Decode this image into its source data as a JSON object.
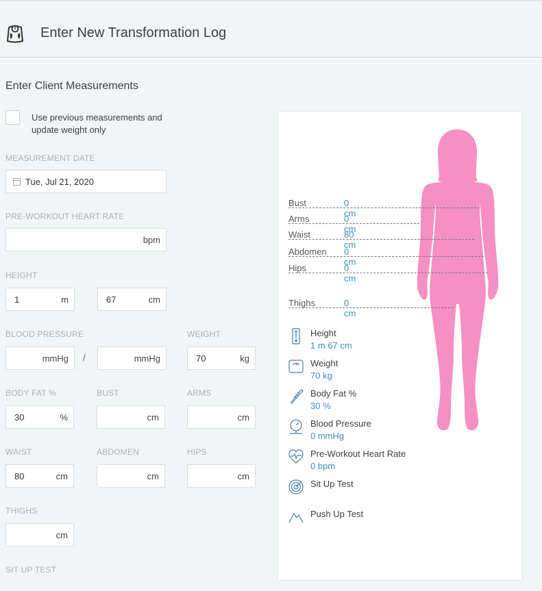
{
  "header": {
    "title": "Enter New Transformation Log",
    "icon": "scale-icon"
  },
  "form": {
    "section_title": "Enter Client Measurements",
    "use_previous_label": "Use previous measurements and update weight only",
    "use_previous_checked": false,
    "measurement_date": {
      "label": "MEASUREMENT DATE",
      "value": "Tue, Jul 21, 2020"
    },
    "heart_rate": {
      "label": "PRE-WORKOUT HEART RATE",
      "value": "",
      "unit": "bpm"
    },
    "height": {
      "label": "HEIGHT",
      "m_value": "1",
      "m_unit": "m",
      "cm_value": "67",
      "cm_unit": "cm"
    },
    "blood_pressure": {
      "label": "BLOOD PRESSURE",
      "systolic": "",
      "systolic_unit": "mmHg",
      "separator": "/",
      "diastolic": "",
      "diastolic_unit": "mmHg"
    },
    "weight": {
      "label": "WEIGHT",
      "value": "70",
      "unit": "kg"
    },
    "body_fat": {
      "label": "BODY FAT %",
      "value": "30",
      "unit": "%"
    },
    "bust": {
      "label": "BUST",
      "value": "",
      "unit": "cm"
    },
    "arms": {
      "label": "ARMS",
      "value": "",
      "unit": "cm"
    },
    "waist": {
      "label": "WAIST",
      "value": "80",
      "unit": "cm"
    },
    "abdomen": {
      "label": "ABDOMEN",
      "value": "",
      "unit": "cm"
    },
    "hips": {
      "label": "HIPS",
      "value": "",
      "unit": "cm"
    },
    "thighs": {
      "label": "THIGHS",
      "value": "",
      "unit": "cm"
    },
    "sit_up": {
      "label": "SIT UP TEST"
    }
  },
  "summary": {
    "body_color": "#f58fc4",
    "accent": "#3d8fc6",
    "measurements": [
      {
        "name": "Bust",
        "value": "0 cm"
      },
      {
        "name": "Arms",
        "value": "0 cm"
      },
      {
        "name": "Waist",
        "value": "80 cm"
      },
      {
        "name": "Abdomen",
        "value": "0 cm"
      },
      {
        "name": "Hips",
        "value": "0 cm"
      },
      {
        "name": "Thighs",
        "value": "0 cm"
      }
    ],
    "stats": [
      {
        "name": "Height",
        "value": "1 m 67 cm",
        "icon": "ruler-icon"
      },
      {
        "name": "Weight",
        "value": "70 kg",
        "icon": "scale-icon"
      },
      {
        "name": "Body Fat %",
        "value": "30 %",
        "icon": "caliper-icon"
      },
      {
        "name": "Blood Pressure",
        "value": "0 mmHg",
        "icon": "gauge-icon"
      },
      {
        "name": "Pre-Workout Heart Rate",
        "value": "0 bpm",
        "icon": "heart-rate-icon"
      },
      {
        "name": "Sit Up Test",
        "value": "",
        "icon": "target-icon"
      },
      {
        "name": "Push Up Test",
        "value": "",
        "icon": "mountain-icon"
      }
    ]
  }
}
